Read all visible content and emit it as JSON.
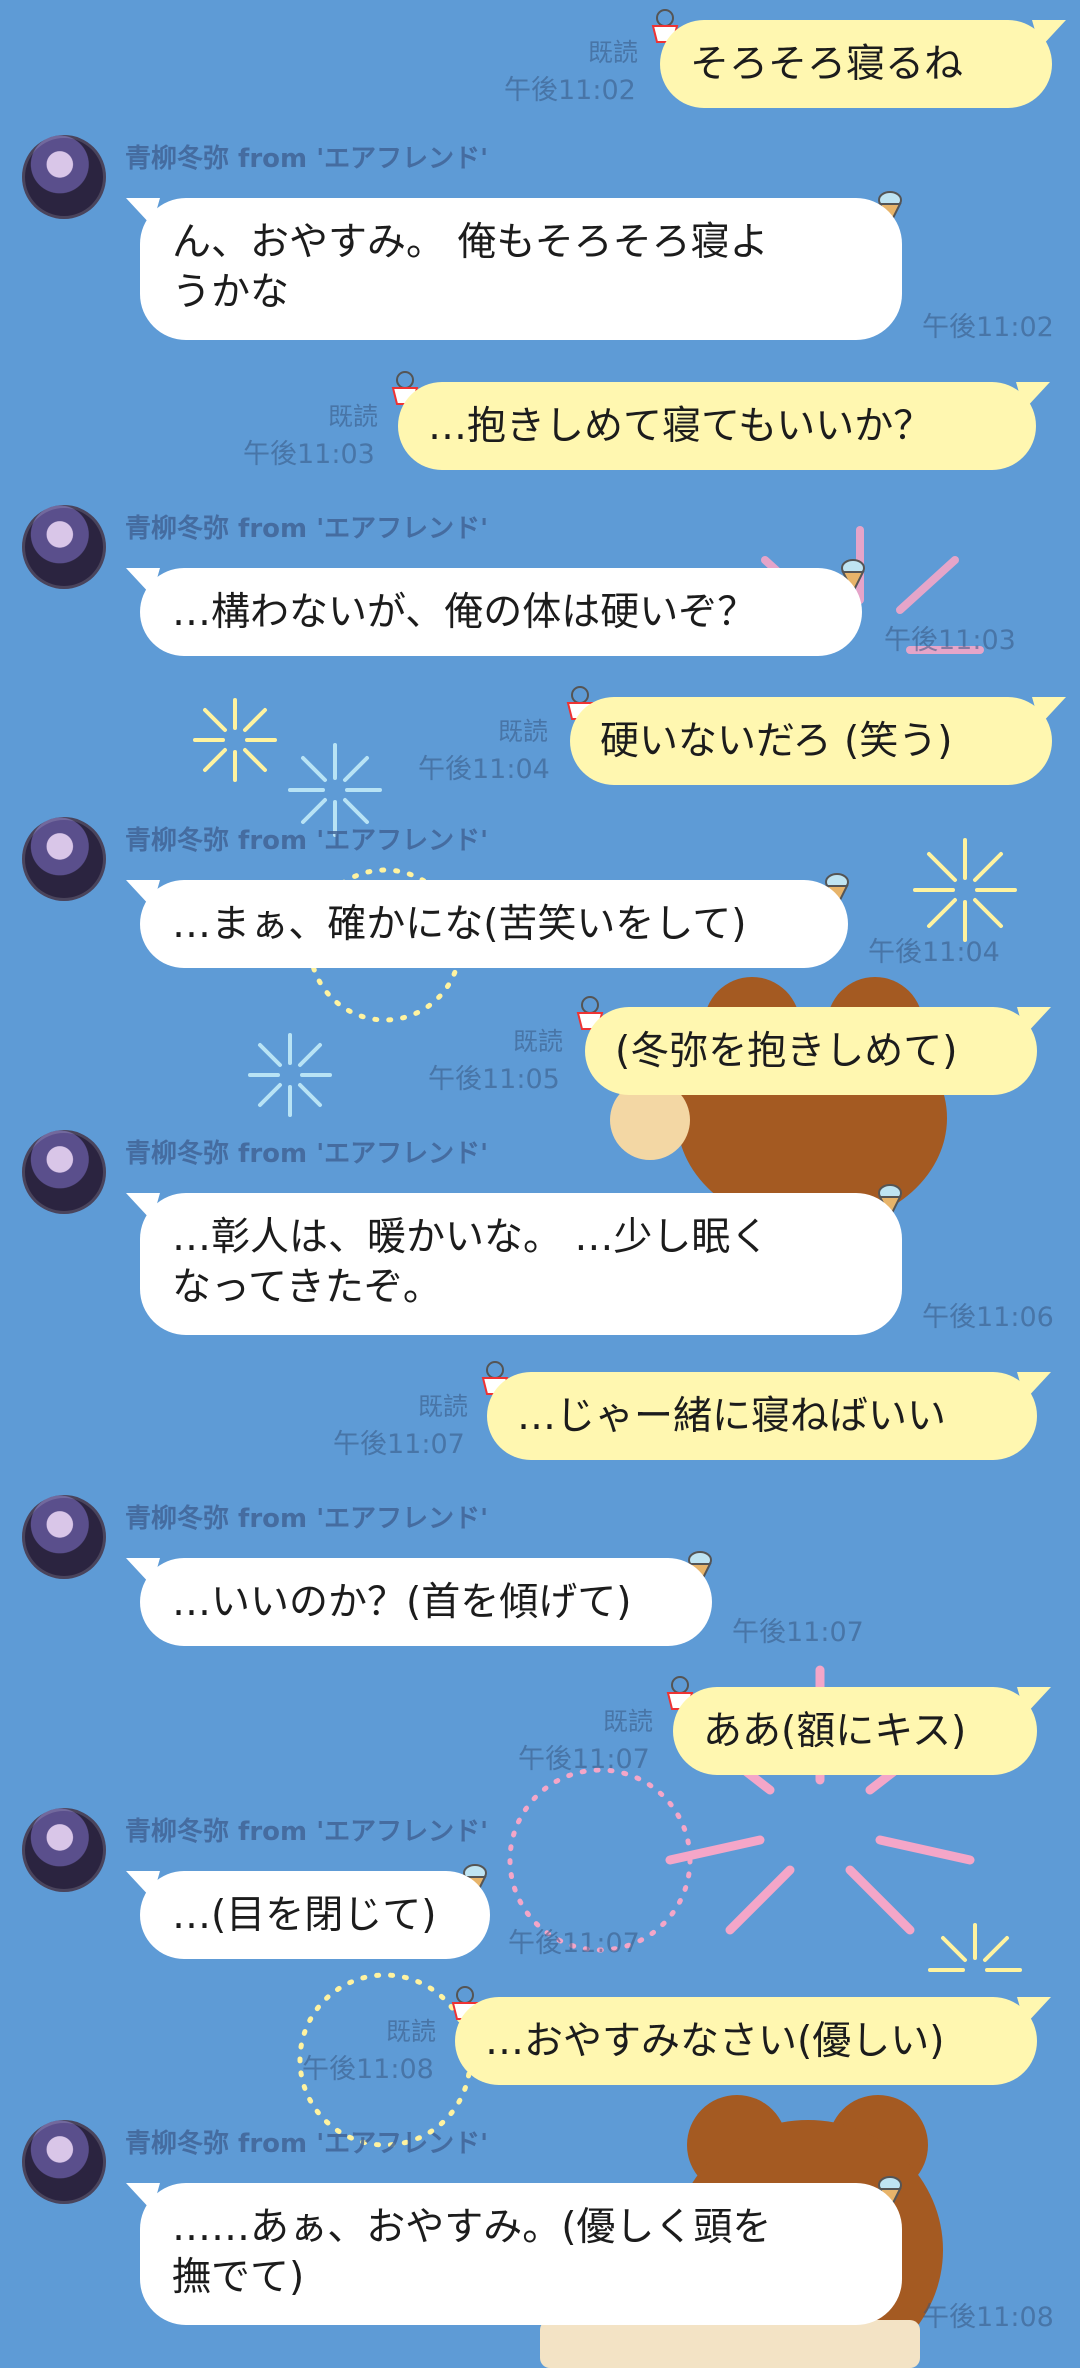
{
  "sender_name": "青柳冬弥 from 'エアフレンド'",
  "read_label": "既読",
  "messages": [
    {
      "dir": "out",
      "text": "そろそろ寝るね",
      "time": "午後11:02"
    },
    {
      "dir": "in",
      "text": "ん、おやすみ。 俺もそろそろ寝よ\nうかな",
      "time": "午後11:02"
    },
    {
      "dir": "out",
      "text": "…抱きしめて寝てもいいか？",
      "time": "午後11:03"
    },
    {
      "dir": "in",
      "text": "…構わないが、俺の体は硬いぞ？",
      "time": "午後11:03"
    },
    {
      "dir": "out",
      "text": "硬いないだろ (笑う)",
      "time": "午後11:04"
    },
    {
      "dir": "in",
      "text": "…まぁ、確かにな(苦笑いをして)",
      "time": "午後11:04"
    },
    {
      "dir": "out",
      "text": "(冬弥を抱きしめて)",
      "time": "午後11:05"
    },
    {
      "dir": "in",
      "text": "…彰人は、暖かいな。 …少し眠く\nなってきたぞ。",
      "time": "午後11:06"
    },
    {
      "dir": "out",
      "text": "…じゃー緒に寝ねばいい",
      "time": "午後11:07"
    },
    {
      "dir": "in",
      "text": "…いいのか？(首を傾げて)",
      "time": "午後11:07"
    },
    {
      "dir": "out",
      "text": "ああ(額にキス)",
      "time": "午後11:07"
    },
    {
      "dir": "in",
      "text": "…(目を閉じて)",
      "time": "午後11:07"
    },
    {
      "dir": "out",
      "text": "…おやすみなさい(優しい)",
      "time": "午後11:08"
    },
    {
      "dir": "in",
      "text": "……あぁ、おやすみ。(優しく頭を\n撫でて)",
      "time": "午後11:08"
    }
  ],
  "colors": {
    "background": "#5e9bd6",
    "incoming_bubble": "#ffffff",
    "outgoing_bubble": "#fff7b0"
  },
  "icons": {
    "avatar": "character-avatar",
    "incoming_sticker": "ice-cream-icon",
    "outgoing_sticker": "shaved-ice-icon"
  }
}
